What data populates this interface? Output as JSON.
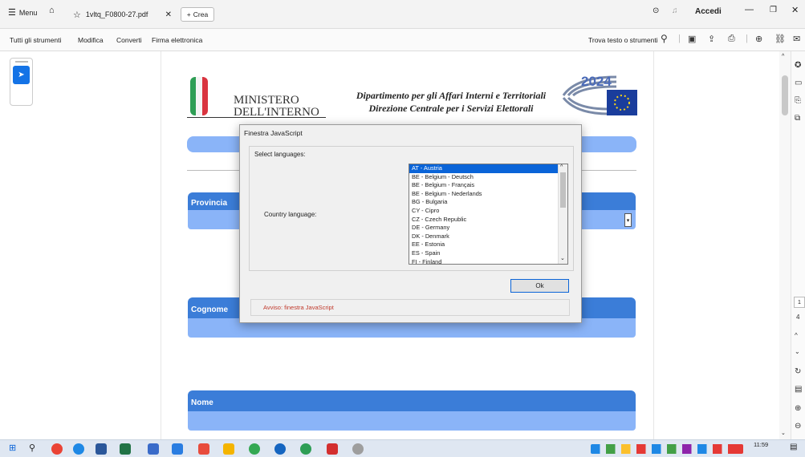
{
  "titlebar": {
    "menu_label": "Menu",
    "tab_title": "1vltq_F0800-27.pdf",
    "new_tab_label": "Crea",
    "signin_label": "Accedi"
  },
  "toolbar": {
    "items": [
      "Tutti gli strumenti",
      "Modifica",
      "Converti",
      "Firma elettronica"
    ],
    "search_label": "Trova testo o strumenti"
  },
  "document": {
    "ministry_line1": "MINISTERO",
    "ministry_line2": "DELL'INTERNO",
    "dept_line1": "Dipartimento per gli Affari Interni e Territoriali",
    "dept_line2": "Direzione Centrale per i Servizi Elettorali",
    "year_badge": "2024",
    "fields": {
      "provincia": "Provincia",
      "cognome": "Cognome",
      "nome": "Nome"
    }
  },
  "dialog": {
    "title": "Finestra JavaScript",
    "group_label": "Select languages:",
    "field_label": "Country language:",
    "options": [
      "AT - Austria",
      "BE - Belgium - Deutsch",
      "BE - Belgium - Français",
      "BE - Belgium - Nederlands",
      "BG - Bulgaria",
      "CY - Cipro",
      "CZ - Czech Republic",
      "DE - Germany",
      "DK - Denmark",
      "EE - Estonia",
      "ES - Spain",
      "FI - Finland"
    ],
    "selected_index": 0,
    "ok_label": "Ok",
    "warning": "Avviso: finestra JavaScript"
  },
  "right_panel": {
    "page_current": "1",
    "page_total": "4"
  },
  "taskbar": {
    "time": "11:59"
  },
  "colors": {
    "accent": "#1473e6",
    "field_header": "#3b7dd8",
    "field_body": "#8ab4f8",
    "warning_text": "#c0392b"
  }
}
